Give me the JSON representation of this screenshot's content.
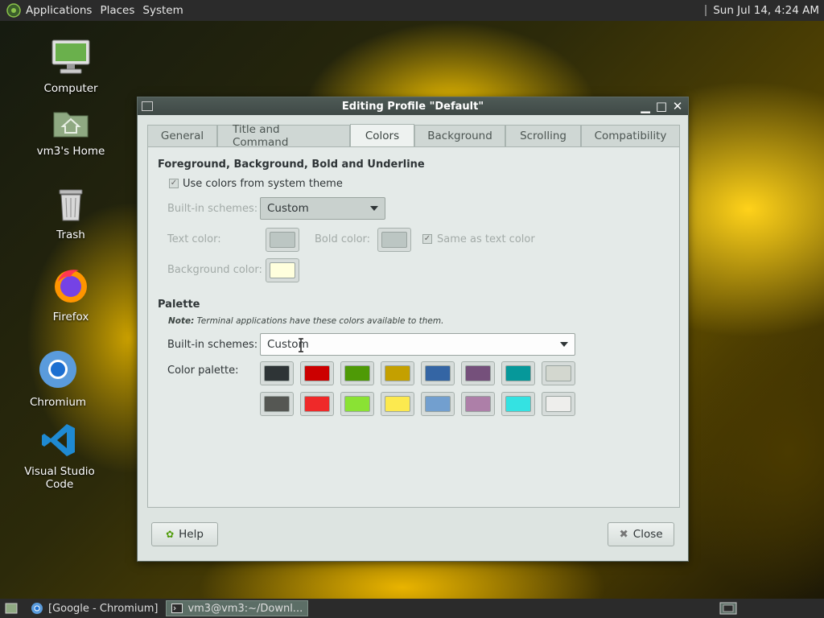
{
  "top_panel": {
    "menus": [
      "Applications",
      "Places",
      "System"
    ],
    "clock": "Sun Jul 14,  4:24 AM"
  },
  "desktop_icons": [
    {
      "label": "Computer"
    },
    {
      "label": "vm3's Home"
    },
    {
      "label": "Trash"
    },
    {
      "label": "Firefox"
    },
    {
      "label": "Chromium"
    },
    {
      "label": "Visual Studio Code"
    }
  ],
  "window": {
    "title": "Editing Profile \"Default\"",
    "tabs": [
      "General",
      "Title and Command",
      "Colors",
      "Background",
      "Scrolling",
      "Compatibility"
    ],
    "active_tab": "Colors",
    "fg_section": {
      "title": "Foreground, Background, Bold and Underline",
      "use_system_label": "Use colors from system theme",
      "builtin_label": "Built-in schemes:",
      "builtin_value": "Custom",
      "text_color_label": "Text color:",
      "bold_color_label": "Bold color:",
      "same_as_text_label": "Same as text color",
      "bg_color_label": "Background color:",
      "text_color": "#bcc6c3",
      "bold_color": "#bcc6c3",
      "bg_color": "#ffffdd"
    },
    "palette_section": {
      "title": "Palette",
      "note_bold": "Note:",
      "note_text": " Terminal applications have these colors available to them.",
      "builtin_label": "Built-in schemes:",
      "builtin_value": "Custom",
      "palette_label": "Color palette:",
      "colors": [
        "#2e3436",
        "#cc0000",
        "#4e9a06",
        "#c4a000",
        "#3465a4",
        "#75507b",
        "#06989a",
        "#d3d7cf",
        "#555753",
        "#ef2929",
        "#8ae234",
        "#fce94f",
        "#729fcf",
        "#ad7fa8",
        "#34e2e2",
        "#eeeeec"
      ]
    },
    "help_label": "Help",
    "close_label": "Close"
  },
  "taskbar": {
    "items": [
      "[Google - Chromium]",
      "vm3@vm3:~/Downl..."
    ]
  }
}
